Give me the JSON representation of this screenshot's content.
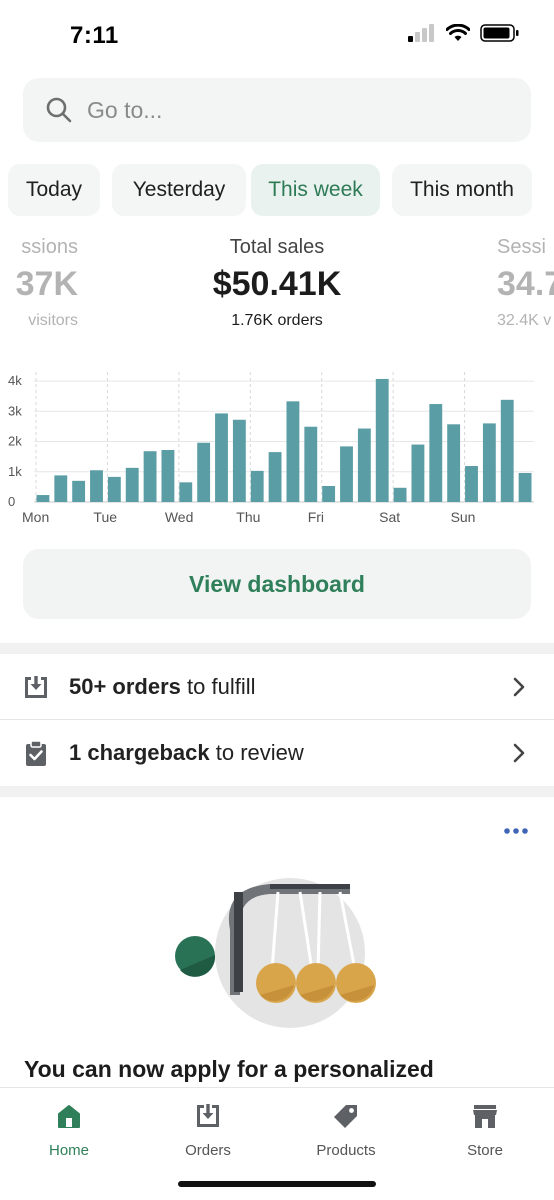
{
  "status_bar": {
    "time": "7:11"
  },
  "search": {
    "placeholder": "Go to..."
  },
  "tabs": [
    {
      "label": "Today"
    },
    {
      "label": "Yesterday"
    },
    {
      "label": "This week",
      "active": true
    },
    {
      "label": "This month"
    }
  ],
  "metrics": {
    "left": {
      "label": "ssions",
      "value": "37K",
      "sub": "visitors"
    },
    "center": {
      "label": "Total sales",
      "value": "$50.41K",
      "sub": "1.76K orders"
    },
    "right": {
      "label": "Sessi",
      "value": "34.7",
      "sub": "32.4K v"
    }
  },
  "chart_data": {
    "type": "bar",
    "x_labels": [
      "Mon",
      "Tue",
      "Wed",
      "Thu",
      "Fri",
      "Sat",
      "Sun"
    ],
    "y_ticks": [
      "0",
      "1k",
      "2k",
      "3k",
      "4k"
    ],
    "ylim": [
      0,
      4300
    ],
    "grid": true,
    "values": [
      230,
      880,
      700,
      1050,
      830,
      1130,
      1680,
      1720,
      650,
      1960,
      2930,
      2720,
      1030,
      1650,
      3330,
      2490,
      530,
      1840,
      2430,
      4070,
      470,
      1900,
      3240,
      2570,
      1190,
      2600,
      3380,
      960
    ],
    "color": "#5a9da4"
  },
  "dashboard_button": {
    "label": "View dashboard"
  },
  "tasks": [
    {
      "bold": "50+ orders",
      "text": " to fulfill"
    },
    {
      "bold": "1 chargeback",
      "text": " to review"
    }
  ],
  "promo": {
    "title": "You can now apply for a personalized"
  },
  "nav": [
    {
      "label": "Home",
      "icon": "home-icon",
      "active": true
    },
    {
      "label": "Orders",
      "icon": "orders-icon"
    },
    {
      "label": "Products",
      "icon": "tag-icon"
    },
    {
      "label": "Store",
      "icon": "store-icon"
    }
  ],
  "colors": {
    "accent": "#2f7f5a",
    "bar": "#5a9da4"
  }
}
